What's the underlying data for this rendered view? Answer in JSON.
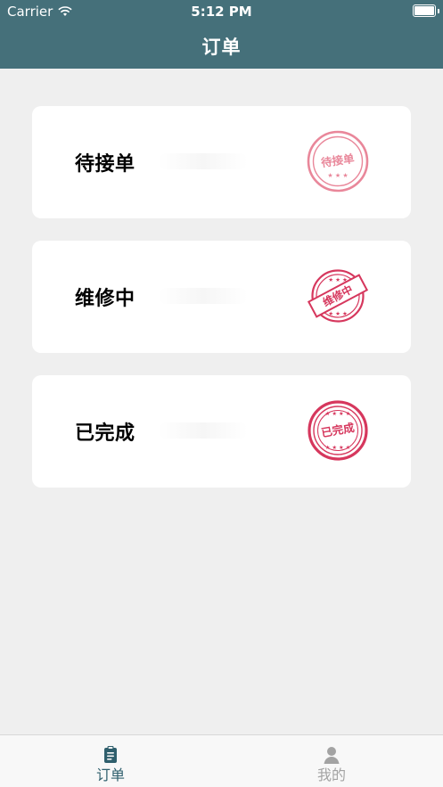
{
  "status_bar": {
    "carrier": "Carrier",
    "time": "5:12 PM"
  },
  "header": {
    "title": "订单",
    "background": "#45707a"
  },
  "orders": {
    "items": [
      {
        "label": "待接单",
        "stamp_text": "待接单",
        "stamp_icon": "pending-stamp-icon",
        "stamp_color": "#e9879a"
      },
      {
        "label": "维修中",
        "stamp_text": "维修中",
        "stamp_icon": "repair-stamp-icon",
        "stamp_color": "#d6375d"
      },
      {
        "label": "已完成",
        "stamp_text": "已完成",
        "stamp_icon": "completed-stamp-icon",
        "stamp_color": "#d6375d"
      }
    ]
  },
  "tab_bar": {
    "items": [
      {
        "label": "订单",
        "icon": "clipboard-icon",
        "active": true,
        "color": "#2f5f6d"
      },
      {
        "label": "我的",
        "icon": "user-icon",
        "active": false,
        "color": "#a3a3a3"
      }
    ]
  }
}
